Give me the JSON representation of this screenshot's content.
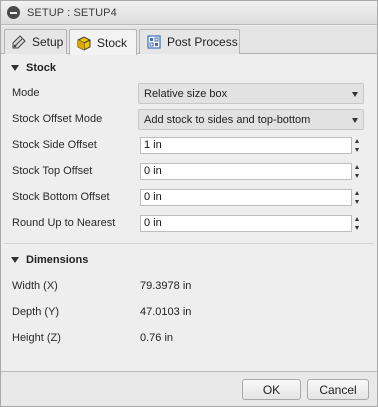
{
  "window": {
    "title": "SETUP : SETUP4"
  },
  "tabs": [
    {
      "label": "Setup",
      "icon": "setup-icon"
    },
    {
      "label": "Stock",
      "icon": "stock-box-icon"
    },
    {
      "label": "Post Process",
      "icon": "post-process-icon"
    }
  ],
  "stock": {
    "section_title": "Stock",
    "mode": {
      "label": "Mode",
      "value": "Relative size box"
    },
    "offset_mode": {
      "label": "Stock Offset Mode",
      "value": "Add stock to sides and top-bottom"
    },
    "side_offset": {
      "label": "Stock Side Offset",
      "value": "1 in"
    },
    "top_offset": {
      "label": "Stock Top Offset",
      "value": "0 in"
    },
    "bottom_offset": {
      "label": "Stock Bottom Offset",
      "value": "0 in"
    },
    "round_up": {
      "label": "Round Up to Nearest",
      "value": "0 in"
    }
  },
  "dimensions": {
    "section_title": "Dimensions",
    "width": {
      "label": "Width (X)",
      "value": "79.3978 in"
    },
    "depth": {
      "label": "Depth (Y)",
      "value": "47.0103 in"
    },
    "height": {
      "label": "Height (Z)",
      "value": "0.76 in"
    }
  },
  "footer": {
    "ok_label": "OK",
    "cancel_label": "Cancel"
  },
  "colors": {
    "active_tab_icon": "#f2c500",
    "post_icon": "#3b6fb6"
  }
}
